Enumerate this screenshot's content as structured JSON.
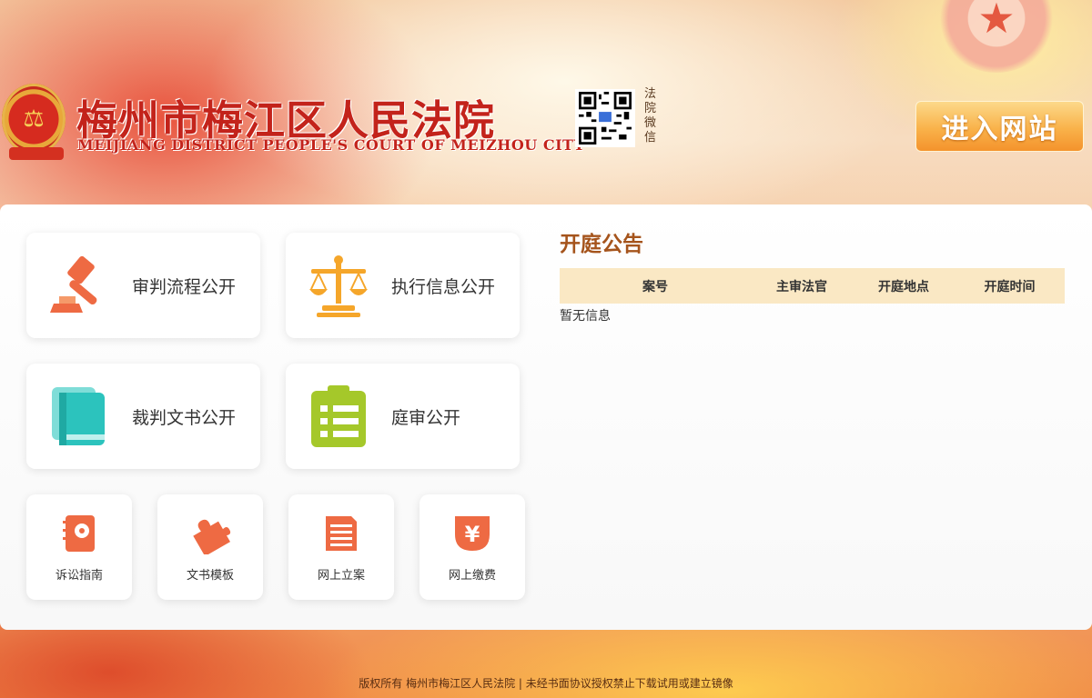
{
  "header": {
    "title": "梅州市梅江区人民法院",
    "subtitle": "MEIJIANG DISTRICT PEOPLE'S COURT OF MEIZHOU CITY",
    "qr_label": "法院微信",
    "enter_button": "进入网站",
    "emblem_icon": "court-emblem-icon"
  },
  "colors": {
    "brand_red": "#c3231b",
    "accent_orange": "#f9b24a",
    "notice_title": "#a5541c",
    "table_header_bg": "#fae8c4"
  },
  "services": {
    "big": [
      {
        "label": "审判流程公开",
        "icon": "gavel-icon",
        "color": "#ee6a43"
      },
      {
        "label": "执行信息公开",
        "icon": "scales-icon",
        "color": "#f5a62a"
      },
      {
        "label": "裁判文书公开",
        "icon": "book-icon",
        "color": "#2cc3bd"
      },
      {
        "label": "庭审公开",
        "icon": "clipboard-list-icon",
        "color": "#a5c82a"
      }
    ],
    "small": [
      {
        "label": "诉讼指南",
        "icon": "guide-book-icon",
        "color": "#ee6a43"
      },
      {
        "label": "文书模板",
        "icon": "puzzle-icon",
        "color": "#ee6a43"
      },
      {
        "label": "网上立案",
        "icon": "document-lines-icon",
        "color": "#ee6a43"
      },
      {
        "label": "网上缴费",
        "icon": "yen-icon",
        "color": "#ee6a43"
      }
    ]
  },
  "notice": {
    "title": "开庭公告",
    "columns": [
      "案号",
      "主审法官",
      "开庭地点",
      "开庭时间"
    ],
    "empty_text": "暂无信息"
  },
  "footer": {
    "text": "版权所有  梅州市梅江区人民法院  |  未经书面协议授权禁止下载试用或建立镜像"
  }
}
